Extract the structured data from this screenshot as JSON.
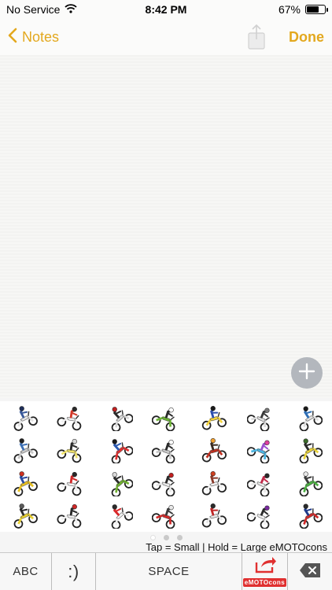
{
  "status_bar": {
    "carrier": "No Service",
    "time": "8:42 PM",
    "battery_percent": "67%",
    "battery_level": 0.67
  },
  "nav": {
    "back_label": "Notes",
    "done_label": "Done"
  },
  "keyboard": {
    "page_count": 3,
    "active_page": 0,
    "hint": "Tap = Small | Hold = Large eMOTOcons",
    "keys": {
      "abc": "ABC",
      "emoticon": ":)",
      "space": "SPACE",
      "brand": "eMOTOcons"
    },
    "stickers": [
      {
        "rider": "#3a5a9a",
        "bike": "#e3e3e3",
        "accent": "#1f2f5a"
      },
      {
        "rider": "#d23a2a",
        "bike": "#f0f0f0",
        "accent": "#2a2a2a"
      },
      {
        "rider": "#2a2a2a",
        "bike": "#d8d8d8",
        "accent": "#c02020"
      },
      {
        "rider": "#2a2a2a",
        "bike": "#6bb234",
        "accent": "#ffffff"
      },
      {
        "rider": "#2c4fae",
        "bike": "#f2d23c",
        "accent": "#1a1a1a"
      },
      {
        "rider": "#3a3a3a",
        "bike": "#dcdcdc",
        "accent": "#7a7a7a"
      },
      {
        "rider": "#2f6fb6",
        "bike": "#e0e0e0",
        "accent": "#1a1a1a"
      },
      {
        "rider": "#3c6fb4",
        "bike": "#c8c8c8",
        "accent": "#222222"
      },
      {
        "rider": "#2a2a2a",
        "bike": "#f0e26a",
        "accent": "#d8d8d8"
      },
      {
        "rider": "#2b59b0",
        "bike": "#e03030",
        "accent": "#1a1a1a"
      },
      {
        "rider": "#2a2a2a",
        "bike": "#c8c8c8",
        "accent": "#ffffff"
      },
      {
        "rider": "#3a2a20",
        "bike": "#c03020",
        "accent": "#f0a030"
      },
      {
        "rider": "#9b4fd0",
        "bike": "#4ab4e0",
        "accent": "#e040a0"
      },
      {
        "rider": "#2a2a2a",
        "bike": "#e8d23a",
        "accent": "#3a6a2a"
      },
      {
        "rider": "#2a4aa0",
        "bike": "#e8c020",
        "accent": "#d03020"
      },
      {
        "rider": "#d02828",
        "bike": "#f0f0f0",
        "accent": "#2a2a2a"
      },
      {
        "rider": "#2a2a2a",
        "bike": "#6fb030",
        "accent": "#d8d8d8"
      },
      {
        "rider": "#2a2a2a",
        "bike": "#e8e8e8",
        "accent": "#c02020"
      },
      {
        "rider": "#8a3a2a",
        "bike": "#f0f0f0",
        "accent": "#d04020"
      },
      {
        "rider": "#c02a4a",
        "bike": "#e8e8e8",
        "accent": "#2a2a2a"
      },
      {
        "rider": "#3a3a3a",
        "bike": "#4ab040",
        "accent": "#e8e8e8"
      },
      {
        "rider": "#2a2a2a",
        "bike": "#e8d030",
        "accent": "#5a5a5a"
      },
      {
        "rider": "#2a2a2a",
        "bike": "#f0f0f0",
        "accent": "#d02828"
      },
      {
        "rider": "#d8282a",
        "bike": "#f0f0f0",
        "accent": "#2a2a2a"
      },
      {
        "rider": "#3a3a3a",
        "bike": "#d02828",
        "accent": "#e8e8e8"
      },
      {
        "rider": "#c02828",
        "bike": "#e8e8e8",
        "accent": "#2a2a2a"
      },
      {
        "rider": "#2a2a2a",
        "bike": "#f0f0f0",
        "accent": "#7a2aa0"
      },
      {
        "rider": "#1f3a8a",
        "bike": "#d02828",
        "accent": "#2a2a2a"
      }
    ]
  },
  "colors": {
    "accent": "#e3a81e",
    "brand_red": "#e03030"
  },
  "icons": {
    "back": "chevron-left-icon",
    "share": "share-icon",
    "add": "plus-icon",
    "delete": "backspace-icon",
    "brand": "emotocons-share-icon"
  }
}
